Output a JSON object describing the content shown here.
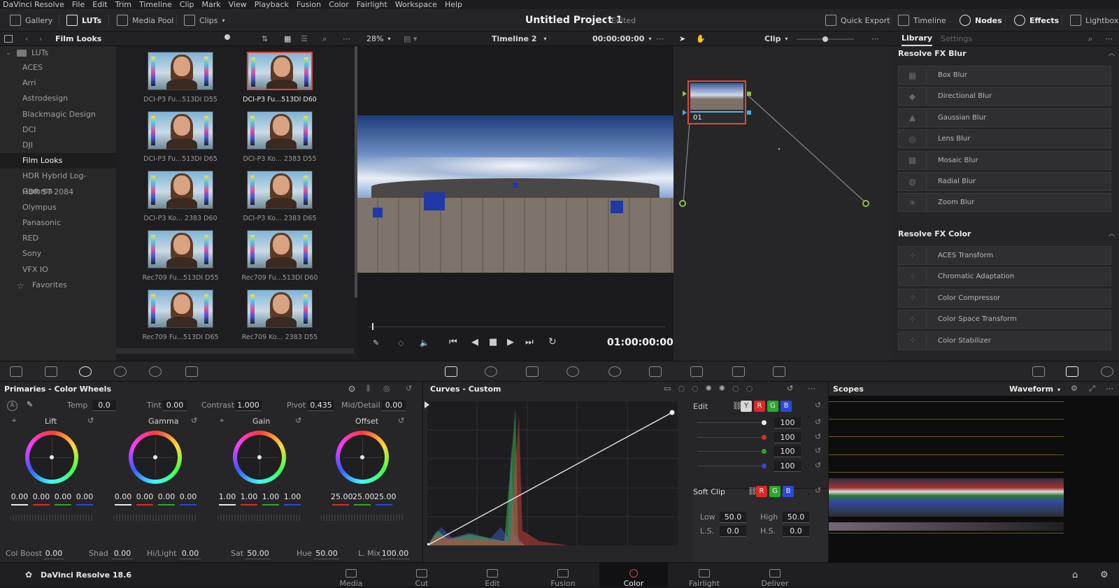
{
  "menu": [
    "DaVinci Resolve",
    "File",
    "Edit",
    "Trim",
    "Timeline",
    "Clip",
    "Mark",
    "View",
    "Playback",
    "Fusion",
    "Color",
    "Fairlight",
    "Workspace",
    "Help"
  ],
  "toolbar": {
    "gallery": "Gallery",
    "luts": "LUTs",
    "media_pool": "Media Pool",
    "clips": "Clips",
    "project_title": "Untitled Project 1",
    "project_status": "Edited",
    "quick_export": "Quick Export",
    "timeline": "Timeline",
    "nodes": "Nodes",
    "effects": "Effects",
    "lightbox": "Lightbox"
  },
  "subbar": {
    "folder_title": "Film Looks",
    "zoom": "28%",
    "timeline_name": "Timeline 2",
    "timecode": "00:00:00:00",
    "clip_mode": "Clip",
    "library_tab": "Library",
    "settings_tab": "Settings"
  },
  "lut_tree": {
    "root": "LUTs",
    "items": [
      "ACES",
      "Arri",
      "Astrodesign",
      "Blackmagic Design",
      "DCI",
      "DJI",
      "Film Looks",
      "HDR Hybrid Log-Gamma",
      "HDR ST 2084",
      "Olympus",
      "Panasonic",
      "RED",
      "Sony",
      "VFX IO"
    ],
    "active_index": 6,
    "favorites": "Favorites"
  },
  "thumbnails": [
    {
      "label": "DCI-P3 Fu...513DI D55",
      "selected": false
    },
    {
      "label": "DCI-P3 Fu...513DI D60",
      "selected": true
    },
    {
      "label": "DCI-P3 Fu...513DI D65",
      "selected": false
    },
    {
      "label": "DCI-P3 Ko... 2383 D55",
      "selected": false
    },
    {
      "label": "DCI-P3 Ko... 2383 D60",
      "selected": false
    },
    {
      "label": "DCI-P3 Ko... 2383 D65",
      "selected": false
    },
    {
      "label": "Rec709 Fu...513DI D55",
      "selected": false
    },
    {
      "label": "Rec709 Fu...513DI D60",
      "selected": false
    },
    {
      "label": "Rec709 Fu...513DI D65",
      "selected": false
    },
    {
      "label": "Rec709 Ko... 2383 D55",
      "selected": false
    }
  ],
  "viewer": {
    "playback_timecode": "01:00:00:00"
  },
  "node": {
    "label": "01"
  },
  "fx": {
    "blur_header": "Resolve FX Blur",
    "blur_items": [
      "Box Blur",
      "Directional Blur",
      "Gaussian Blur",
      "Lens Blur",
      "Mosaic Blur",
      "Radial Blur",
      "Zoom Blur"
    ],
    "color_header": "Resolve FX Color",
    "color_items": [
      "ACES Transform",
      "Chromatic Adaptation",
      "Color Compressor",
      "Color Space Transform",
      "Color Stabilizer"
    ]
  },
  "primaries": {
    "title": "Primaries - Color Wheels",
    "temp_label": "Temp",
    "temp": "0.0",
    "tint_label": "Tint",
    "tint": "0.00",
    "contrast_label": "Contrast",
    "contrast": "1.000",
    "pivot_label": "Pivot",
    "pivot": "0.435",
    "middetail_label": "Mid/Detail",
    "middetail": "0.00",
    "wheels": [
      {
        "name": "Lift",
        "values": [
          "0.00",
          "0.00",
          "0.00",
          "0.00"
        ]
      },
      {
        "name": "Gamma",
        "values": [
          "0.00",
          "0.00",
          "0.00",
          "0.00"
        ]
      },
      {
        "name": "Gain",
        "values": [
          "1.00",
          "1.00",
          "1.00",
          "1.00"
        ]
      },
      {
        "name": "Offset",
        "values": [
          "25.00",
          "25.00",
          "25.00"
        ]
      }
    ],
    "colboost_label": "Col Boost",
    "colboost": "0.00",
    "shad_label": "Shad",
    "shad": "0.00",
    "hilight_label": "Hi/Light",
    "hilight": "0.00",
    "sat_label": "Sat",
    "sat": "50.00",
    "hue_label": "Hue",
    "hue": "50.00",
    "lmix_label": "L. Mix",
    "lmix": "100.00"
  },
  "curves": {
    "title": "Curves - Custom",
    "edit_label": "Edit",
    "channels": [
      "Y",
      "R",
      "G",
      "B"
    ],
    "intensities": [
      "100",
      "100",
      "100",
      "100"
    ],
    "softclip_label": "Soft Clip",
    "low_label": "Low",
    "low": "50.0",
    "high_label": "High",
    "high": "50.0",
    "ls_label": "L.S.",
    "ls": "0.0",
    "hs_label": "H.S.",
    "hs": "0.0"
  },
  "scopes": {
    "title": "Scopes",
    "mode": "Waveform"
  },
  "pagebar": {
    "app_version": "DaVinci Resolve 18.6",
    "pages": [
      "Media",
      "Cut",
      "Edit",
      "Fusion",
      "Color",
      "Fairlight",
      "Deliver"
    ],
    "active_page": "Color"
  },
  "colors": {
    "accent_red": "#e0483a",
    "bg": "#1a1a1c",
    "panel": "#262628"
  }
}
